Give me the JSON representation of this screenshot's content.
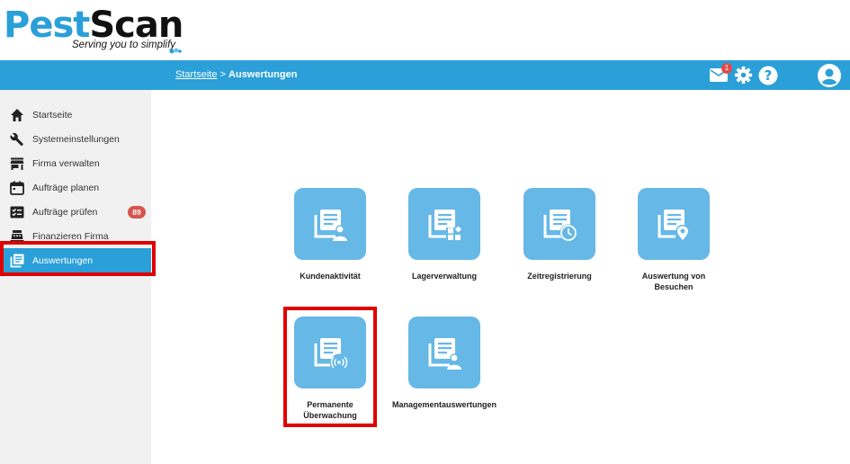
{
  "brand": {
    "name_part1": "Pest",
    "name_part2": "Scan",
    "tagline": "Serving you to simplify",
    "color_primary": "#2a9fd8"
  },
  "topbar": {
    "breadcrumb_home": "Startseite",
    "breadcrumb_separator": ">",
    "breadcrumb_current": "Auswertungen",
    "mail_count": "1",
    "icons": [
      "mail-icon",
      "gear-icon",
      "help-icon",
      "germany-flag-icon",
      "user-avatar-icon"
    ]
  },
  "sidebar": {
    "items": [
      {
        "label": "Startseite",
        "icon": "home-icon"
      },
      {
        "label": "Systemeinstellungen",
        "icon": "wrench-icon"
      },
      {
        "label": "Firma verwalten",
        "icon": "store-icon"
      },
      {
        "label": "Aufträge planen",
        "icon": "calendar-icon"
      },
      {
        "label": "Aufträge prüfen",
        "icon": "checklist-icon",
        "badge": "89"
      },
      {
        "label": "Finanzieren Firma",
        "icon": "cash-register-icon"
      },
      {
        "label": "Auswertungen",
        "icon": "report-icon",
        "active": true
      }
    ]
  },
  "tiles": [
    {
      "label": "Kundenaktivität",
      "icon": "report-user-icon"
    },
    {
      "label": "Lagerverwaltung",
      "icon": "report-widgets-icon"
    },
    {
      "label": "Zeitregistrierung",
      "icon": "report-clock-icon"
    },
    {
      "label": "Auswertung von\nBesuchen",
      "icon": "report-location-icon"
    },
    {
      "label": "Permanente\nÜberwachung",
      "icon": "report-signal-icon"
    },
    {
      "label": "Managementauswertungen",
      "icon": "report-user-icon"
    }
  ]
}
